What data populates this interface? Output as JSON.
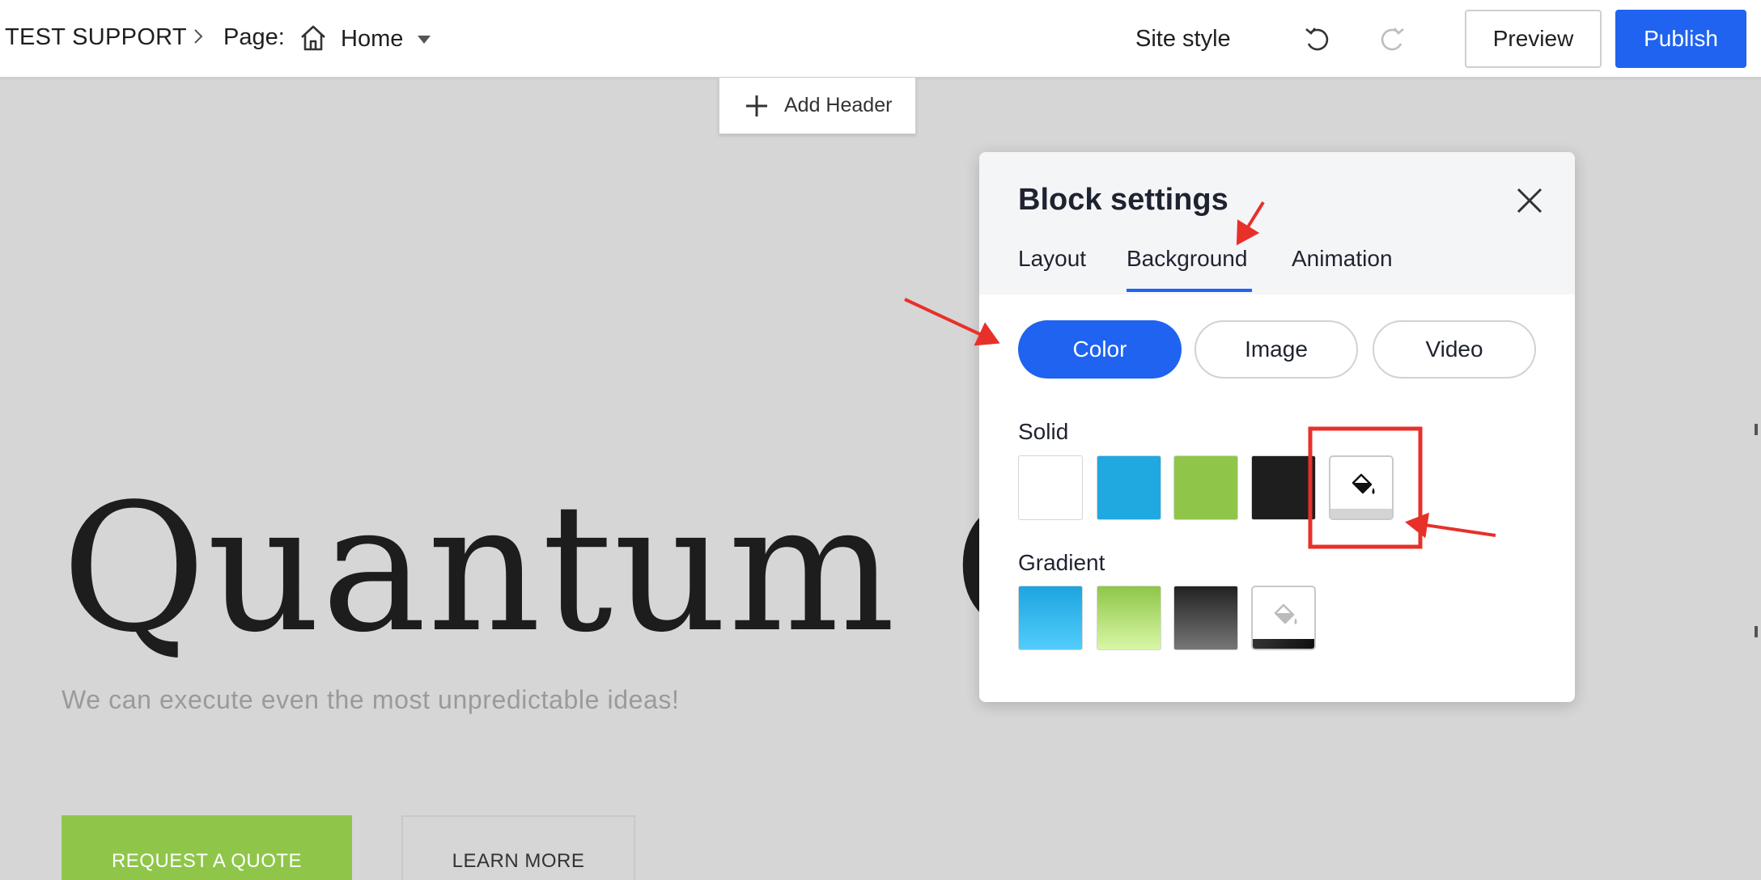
{
  "topbar": {
    "site_name": "TEST SUPPORT",
    "page_label": "Page:",
    "current_page": "Home",
    "site_style_label": "Site style",
    "preview_label": "Preview",
    "publish_label": "Publish"
  },
  "canvas": {
    "add_header_label": "Add Header",
    "hero_title": "Quantum Co",
    "hero_subtitle": "We can execute even the most unpredictable ideas!",
    "primary_cta": "REQUEST A QUOTE",
    "secondary_cta": "LEARN MORE"
  },
  "block_settings": {
    "title": "Block settings",
    "tabs": [
      {
        "label": "Layout",
        "active": false
      },
      {
        "label": "Background",
        "active": true
      },
      {
        "label": "Animation",
        "active": false
      }
    ],
    "background_types": [
      {
        "label": "Color",
        "selected": true
      },
      {
        "label": "Image",
        "selected": false
      },
      {
        "label": "Video",
        "selected": false
      }
    ],
    "solid_label": "Solid",
    "solid_swatches": [
      "#ffffff",
      "#20a8e0",
      "#8fc649",
      "#1e1e1e"
    ],
    "gradient_label": "Gradient",
    "gradient_swatches": [
      [
        "#1ea4e0",
        "#52cdfa"
      ],
      [
        "#8fc649",
        "#d8f7a6"
      ],
      [
        "#222222",
        "#777777"
      ]
    ]
  },
  "colors": {
    "accent": "#1f63f0",
    "annotation": "#e8302a"
  },
  "icons": [
    "chevron-right-icon",
    "home-icon",
    "caret-down-icon",
    "undo-icon",
    "redo-icon",
    "plus-icon",
    "close-icon",
    "paint-bucket-icon"
  ]
}
